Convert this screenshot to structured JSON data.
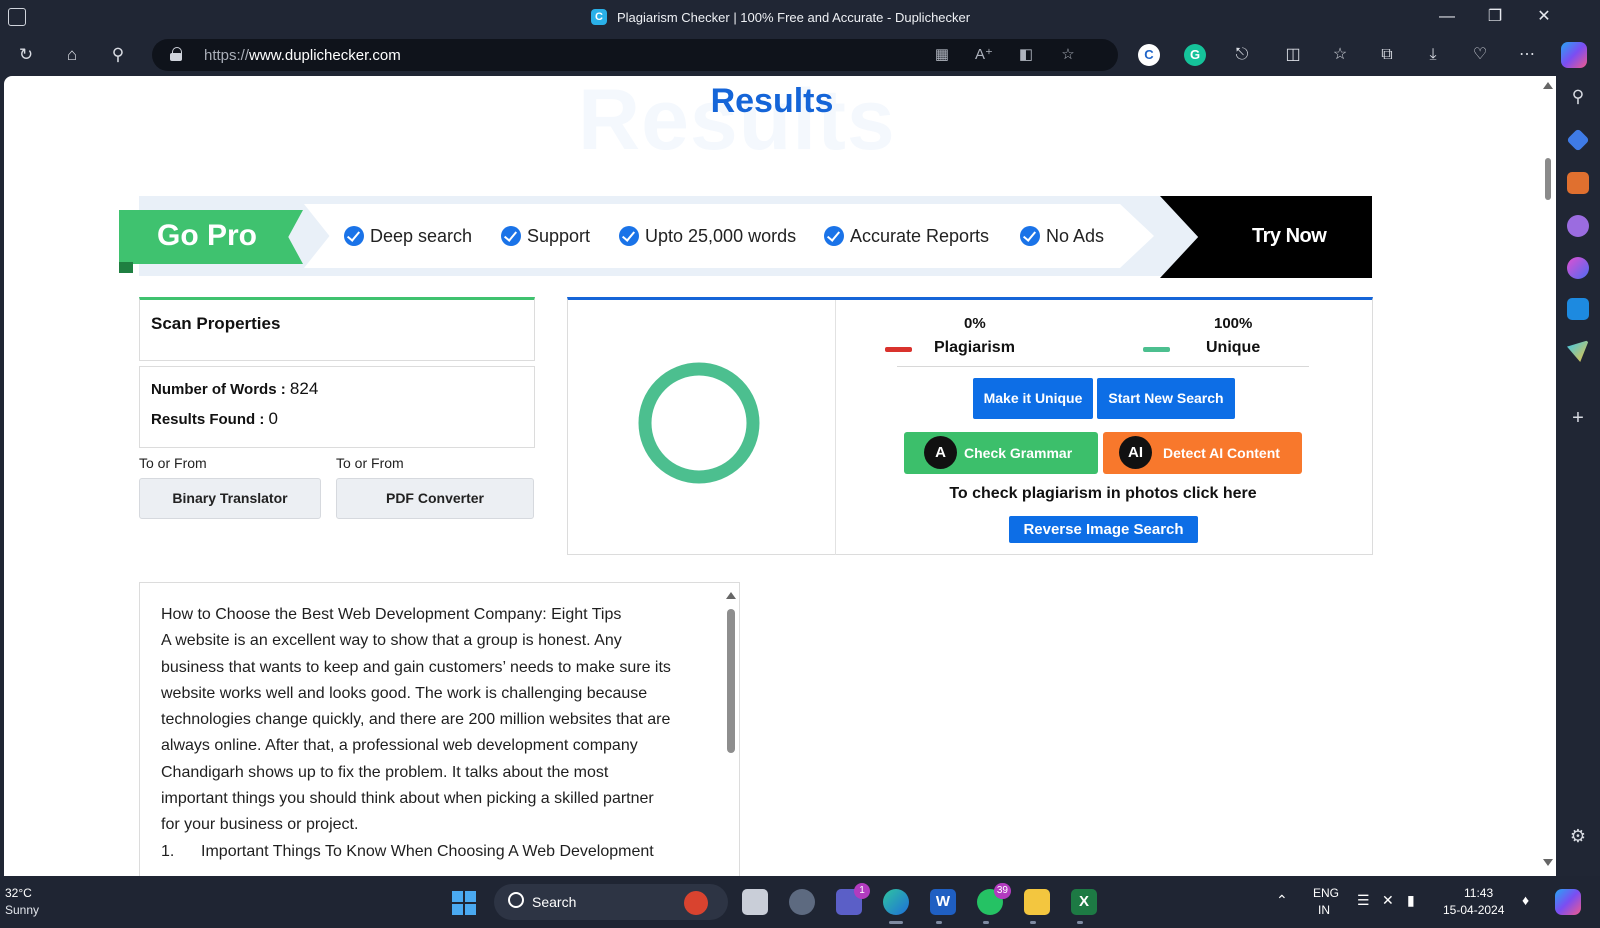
{
  "browser": {
    "tab_title": "Plagiarism Checker | 100% Free and Accurate - Duplichecker",
    "favicon_letter": "C",
    "url_protocol": "https://",
    "url_host": "www.duplichecker.com",
    "controls": [
      "minimize-icon",
      "restore-icon",
      "close-icon"
    ],
    "nav_icons": [
      "refresh-icon",
      "home-icon",
      "search-icon"
    ],
    "address_icons": [
      "app-available-icon",
      "read-aloud-icon",
      "immersive-reader-icon",
      "favorite-star-icon"
    ],
    "toolbar_icons": [
      "copyleaks-extension-icon",
      "grammarly-extension-icon",
      "extensions-icon",
      "split-screen-icon",
      "favorites-icon",
      "collections-icon",
      "downloads-icon",
      "browser-essentials-icon",
      "more-icon",
      "copilot-icon"
    ],
    "ext_c_letter": "C",
    "ext_g_letter": "G",
    "sidebar_icons": [
      "sidebar-search-icon",
      "sidebar-shopping-icon",
      "sidebar-tools-icon",
      "sidebar-games-icon",
      "sidebar-office-icon",
      "sidebar-outlook-icon",
      "sidebar-send-icon",
      "sidebar-add-icon",
      "sidebar-settings-icon"
    ]
  },
  "page": {
    "ghost_heading": "Results",
    "results_title": "Results",
    "banner": {
      "gopro_label": "Go Pro",
      "features": [
        "Deep search",
        "Support",
        "Upto 25,000 words",
        "Accurate Reports",
        "No Ads"
      ],
      "try_now_label": "Try Now"
    },
    "scan": {
      "title": "Scan Properties",
      "words_label": "Number of Words :",
      "words_value": "824",
      "results_label": "Results Found :",
      "results_value": "0"
    },
    "tools": [
      {
        "caption": "To or From",
        "label": "Binary Translator"
      },
      {
        "caption": "To or From",
        "label": "PDF Converter"
      }
    ],
    "result": {
      "plagiarism_pct": "0%",
      "plagiarism_label": "Plagiarism",
      "unique_pct": "100%",
      "unique_label": "Unique",
      "plagiarism_fraction": 0,
      "unique_fraction": 1,
      "plagiarism_color": "#d9322d",
      "unique_color": "#4cbf8f",
      "make_unique_label": "Make it Unique",
      "new_search_label": "Start New Search",
      "grammar_label": "Check Grammar",
      "grammar_badge": "A",
      "ai_label": "Detect AI Content",
      "ai_badge": "AI",
      "photo_text": "To check plagiarism in photos click here",
      "reverse_label": "Reverse Image Search"
    },
    "text_lines": [
      "How to Choose the Best Web Development Company: Eight Tips",
      "A website is an excellent way to show that a group is honest. Any",
      "business that wants to keep and gain customers’ needs to make sure its",
      "website works well and looks good. The work is challenging because",
      "technologies change quickly, and there are 200 million websites that are",
      "always online. After that, a professional web development company",
      "Chandigarh shows up to fix the problem. It talks about the most",
      "important things you should think about when picking a skilled partner",
      "for your business or project.",
      "1.      Important Things To Know When Choosing A Web Development"
    ]
  },
  "taskbar": {
    "temperature": "32°C",
    "weather": "Sunny",
    "search_label": "Search",
    "apps": [
      "start-icon",
      "search-box",
      "task-view-icon",
      "settings-app-icon",
      "teams-icon",
      "edge-icon",
      "word-icon",
      "whatsapp-icon",
      "file-explorer-icon",
      "excel-icon"
    ],
    "teams_badge": "1",
    "whatsapp_badge": "39",
    "word_letter": "W",
    "excel_letter": "X",
    "lang_top": "ENG",
    "lang_bottom": "IN",
    "time": "11:43",
    "date": "15-04-2024"
  }
}
